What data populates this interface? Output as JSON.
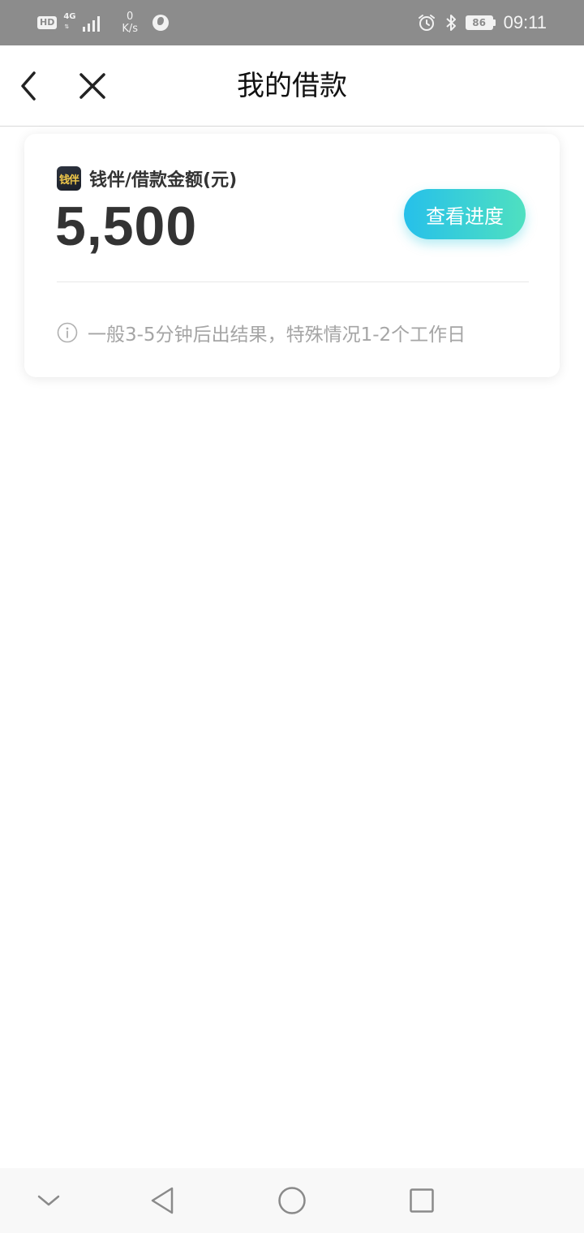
{
  "status_bar": {
    "hd": "HD",
    "network": "4G",
    "speed_value": "0",
    "speed_unit": "K/s",
    "battery": "86",
    "time": "09:11"
  },
  "header": {
    "title": "我的借款"
  },
  "loan_card": {
    "logo_text": "钱伴",
    "amount_label": "钱伴/借款金额(元)",
    "amount": "5,500",
    "progress_button": "查看进度",
    "hint": "一般3-5分钟后出结果，特殊情况1-2个工作日"
  },
  "icons": {
    "back": "back-chevron-icon",
    "close": "close-icon",
    "info": "info-icon",
    "nav_collapse": "chevron-down-icon",
    "nav_back": "triangle-back-icon",
    "nav_home": "circle-home-icon",
    "nav_recent": "square-recent-icon"
  },
  "colors": {
    "status_bar": "#8c8c8c",
    "button_gradient_start": "#26c0ea",
    "button_gradient_end": "#4fe0c0",
    "hint_text": "#a5a5a5"
  }
}
